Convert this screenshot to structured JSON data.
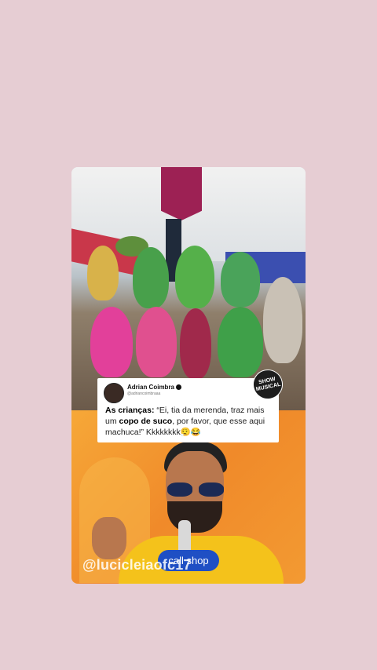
{
  "post": {
    "author_name": "Adrian Coimbra",
    "author_handle": "@adriancoimbraaa",
    "caption_lead": "As crianças:",
    "caption_part1": " “Ei, tia da merenda, traz mais um ",
    "caption_bold": "copo de suco",
    "caption_part2": ", por favor, que esse aqui machuca!” Kkkkkkkk😮‍💨😂"
  },
  "badge": {
    "line1": "SHOW",
    "line2": "MUSICAL"
  },
  "overlay": {
    "watermark": "@lucicleiaofc17",
    "shop_label": "call shop"
  }
}
